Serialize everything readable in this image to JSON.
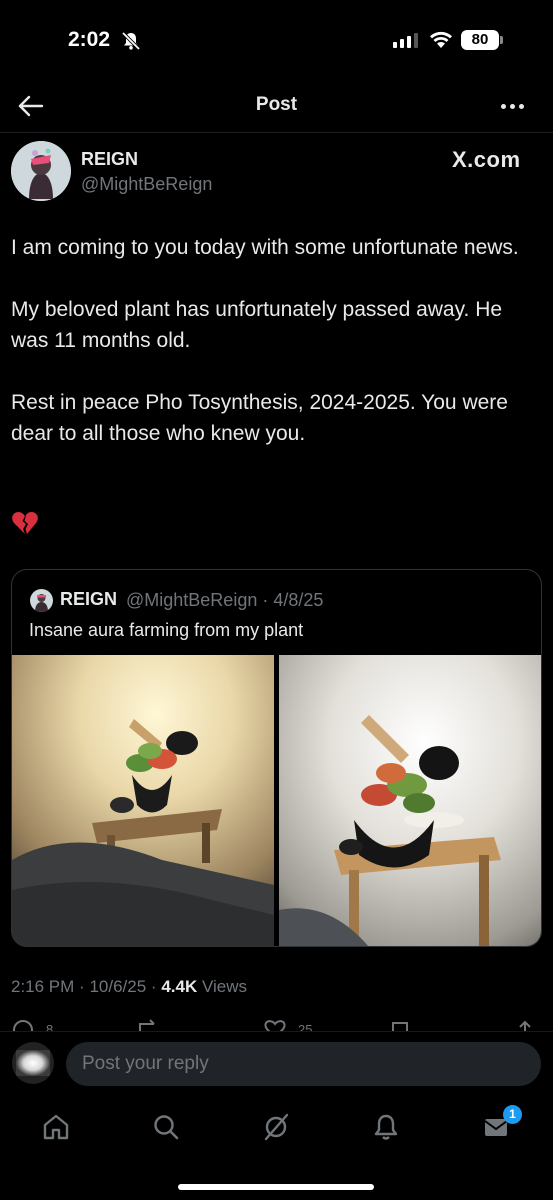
{
  "status_bar": {
    "time": "2:02",
    "battery": "80"
  },
  "nav": {
    "title": "Post"
  },
  "post": {
    "author_name": "REIGN",
    "author_handle": "@MightBeReign",
    "source": "X.com",
    "paragraphs": [
      "I am coming to you today with some unfortunate news.",
      "My beloved plant has unfortunately passed away. He was 11 months old.",
      "Rest in peace Pho Tosynthesis, 2024-2025. You were dear to all those who knew you."
    ],
    "emoji": "💔",
    "time": "2:16 PM",
    "date": "10/6/25",
    "views_count": "4.4K",
    "views_label": "Views",
    "sep": "·"
  },
  "quote": {
    "author_name": "REIGN",
    "author_handle": "@MightBeReign",
    "date": "4/8/25",
    "text": "Insane aura farming from my plant"
  },
  "actions": {
    "replies": "8",
    "likes": "25"
  },
  "reply": {
    "placeholder": "Post your reply"
  },
  "tabs": {
    "messages_badge": "1"
  },
  "icons": [
    "back-arrow-icon",
    "more-icon",
    "bell-off-icon",
    "signal-icon",
    "wifi-icon",
    "battery-icon",
    "home-icon",
    "search-icon",
    "grok-icon",
    "bell-icon",
    "mail-icon",
    "broken-heart-icon"
  ],
  "colors": {
    "background": "#000000",
    "text": "#e7e9ea",
    "secondary": "#71767b",
    "accent": "#1d9bf0",
    "border": "#2f3336"
  }
}
